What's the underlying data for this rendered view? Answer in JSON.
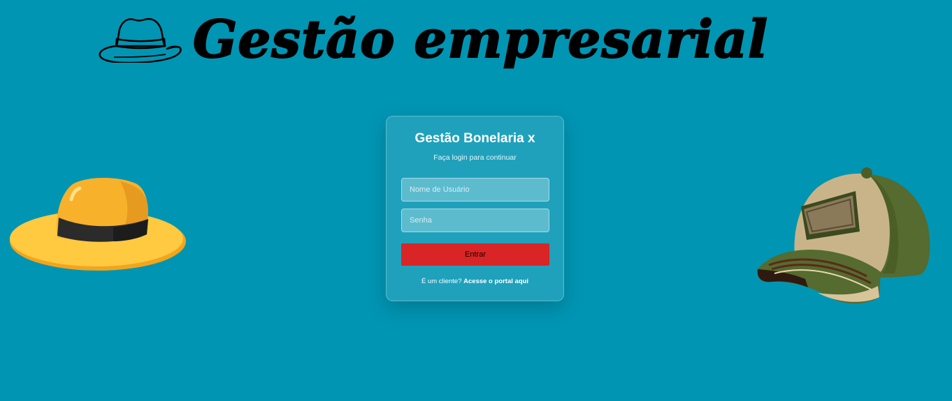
{
  "header": {
    "title": "Gestão empresarial",
    "logo_icon": "fedora-hat-icon"
  },
  "login": {
    "title": "Gestão Bonelaria x",
    "subtitle": "Faça login para continuar",
    "username_placeholder": "Nome de Usuário",
    "password_placeholder": "Senha",
    "submit_label": "Entrar",
    "client_prompt": "É um cliente?",
    "portal_link": "Acesse o portal aqui"
  },
  "decorations": {
    "left_image": "yellow-sun-hat",
    "right_image": "green-baseball-cap"
  },
  "colors": {
    "background": "#0095b3",
    "button": "#d92525",
    "text": "#ffffff"
  }
}
